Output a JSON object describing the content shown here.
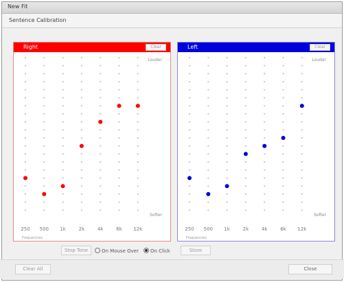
{
  "window": {
    "title": "New Fit"
  },
  "tab": {
    "label": "Sentence Calibration"
  },
  "panels": {
    "right": {
      "title": "Right",
      "clear_label": "Clear",
      "louder_label": "Louder",
      "softer_label": "Softer",
      "freq_axis_label": "Frequencies",
      "color": "#ff0000",
      "frequencies": [
        "250",
        "500",
        "1k",
        "2k",
        "4k",
        "6k",
        "12k"
      ],
      "levels_from_top": [
        null,
        null,
        null,
        null,
        null,
        null,
        null
      ],
      "points": [
        {
          "freq_index": 0,
          "level_index": 15
        },
        {
          "freq_index": 1,
          "level_index": 17
        },
        {
          "freq_index": 2,
          "level_index": 16
        },
        {
          "freq_index": 3,
          "level_index": 11
        },
        {
          "freq_index": 4,
          "level_index": 8
        },
        {
          "freq_index": 5,
          "level_index": 6
        },
        {
          "freq_index": 6,
          "level_index": 6
        }
      ]
    },
    "left": {
      "title": "Left",
      "clear_label": "Clear",
      "louder_label": "Louder",
      "softer_label": "Softer",
      "freq_axis_label": "Frequencies",
      "color": "#0000dd",
      "frequencies": [
        "250",
        "500",
        "1k",
        "2k",
        "4k",
        "6k",
        "12k"
      ],
      "points": [
        {
          "freq_index": 0,
          "level_index": 15
        },
        {
          "freq_index": 1,
          "level_index": 17
        },
        {
          "freq_index": 2,
          "level_index": 16
        },
        {
          "freq_index": 3,
          "level_index": 12
        },
        {
          "freq_index": 4,
          "level_index": 11
        },
        {
          "freq_index": 5,
          "level_index": 10
        },
        {
          "freq_index": 6,
          "level_index": 6
        }
      ]
    }
  },
  "controls": {
    "stop_tone_label": "Stop Tone",
    "radio_mouse_label": "On Mouse Over",
    "radio_click_label": "On Click",
    "radio_selected": "click",
    "store_label": "Store"
  },
  "footer": {
    "clear_all_label": "Clear All",
    "close_label": "Close"
  }
}
